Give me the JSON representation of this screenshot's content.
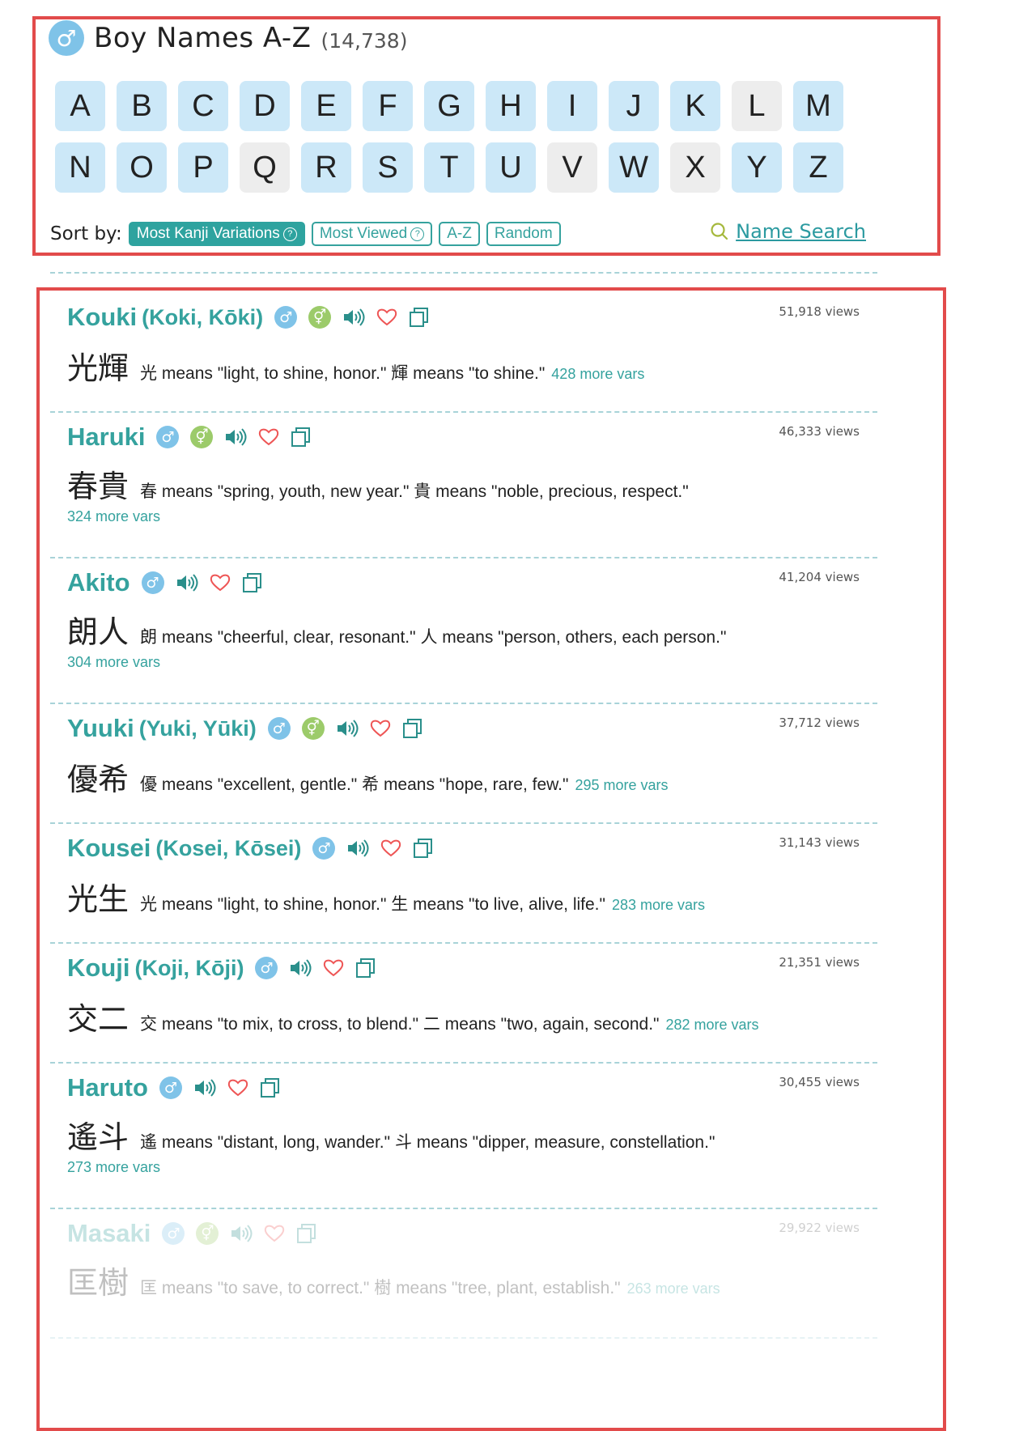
{
  "header": {
    "title": "Boy Names A-Z",
    "count": "(14,738)",
    "gender_icon": "male-symbol-icon"
  },
  "letters_row1": [
    "A",
    "B",
    "C",
    "D",
    "E",
    "F",
    "G",
    "H",
    "I",
    "J",
    "K",
    "L",
    "M"
  ],
  "letters_row2": [
    "N",
    "O",
    "P",
    "Q",
    "R",
    "S",
    "T",
    "U",
    "V",
    "W",
    "X",
    "Y",
    "Z"
  ],
  "sort": {
    "label": "Sort by:",
    "options": [
      "Most Kanji Variations",
      "Most Viewed",
      "A-Z",
      "Random"
    ],
    "active": "Most Kanji Variations"
  },
  "search": {
    "label": "Name Search",
    "icon": "search-icon"
  },
  "accent_color": "#35a29e",
  "entries": [
    {
      "romaji": "Kouki",
      "alts": "(Koki, Kōki)",
      "unisex": true,
      "views": "51,918 views",
      "kanji": "光輝",
      "k1": "光",
      "m1": "means \"light, to shine, honor.\"",
      "k2": "輝",
      "m2": "means \"to shine.\"",
      "more": "428 more vars"
    },
    {
      "romaji": "Haruki",
      "alts": "",
      "unisex": true,
      "views": "46,333 views",
      "kanji": "春貴",
      "k1": "春",
      "m1": "means \"spring, youth, new year.\"",
      "k2": "貴",
      "m2": "means \"noble, precious, respect.\"",
      "more": "324 more vars"
    },
    {
      "romaji": "Akito",
      "alts": "",
      "unisex": false,
      "views": "41,204 views",
      "kanji": "朗人",
      "k1": "朗",
      "m1": "means \"cheerful, clear, resonant.\"",
      "k2": "人",
      "m2": "means \"person, others, each person.\"",
      "more": "304 more vars"
    },
    {
      "romaji": "Yuuki",
      "alts": "(Yuki, Yūki)",
      "unisex": true,
      "views": "37,712 views",
      "kanji": "優希",
      "k1": "優",
      "m1": "means \"excellent, gentle.\"",
      "k2": "希",
      "m2": "means \"hope, rare, few.\"",
      "more": "295 more vars"
    },
    {
      "romaji": "Kousei",
      "alts": "(Kosei, Kōsei)",
      "unisex": false,
      "views": "31,143 views",
      "kanji": "光生",
      "k1": "光",
      "m1": "means \"light, to shine, honor.\"",
      "k2": "生",
      "m2": "means \"to live, alive, life.\"",
      "more": "283 more vars"
    },
    {
      "romaji": "Kouji",
      "alts": "(Koji, Kōji)",
      "unisex": false,
      "views": "21,351 views",
      "kanji": "交二",
      "k1": "交",
      "m1": "means \"to mix, to cross, to blend.\"",
      "k2": "二",
      "m2": "means \"two, again, second.\"",
      "more": "282 more vars"
    },
    {
      "romaji": "Haruto",
      "alts": "",
      "unisex": false,
      "views": "30,455 views",
      "kanji": "遙斗",
      "k1": "遙",
      "m1": "means \"distant, long, wander.\"",
      "k2": "斗",
      "m2": "means \"dipper, measure, constellation.\"",
      "more": "273 more vars"
    },
    {
      "romaji": "Masaki",
      "alts": "",
      "unisex": true,
      "views": "29,922 views",
      "kanji": "匡樹",
      "k1": "匡",
      "m1": "means \"to save, to correct.\"",
      "k2": "樹",
      "m2": "means \"tree, plant, establish.\"",
      "more": "263 more vars"
    }
  ]
}
